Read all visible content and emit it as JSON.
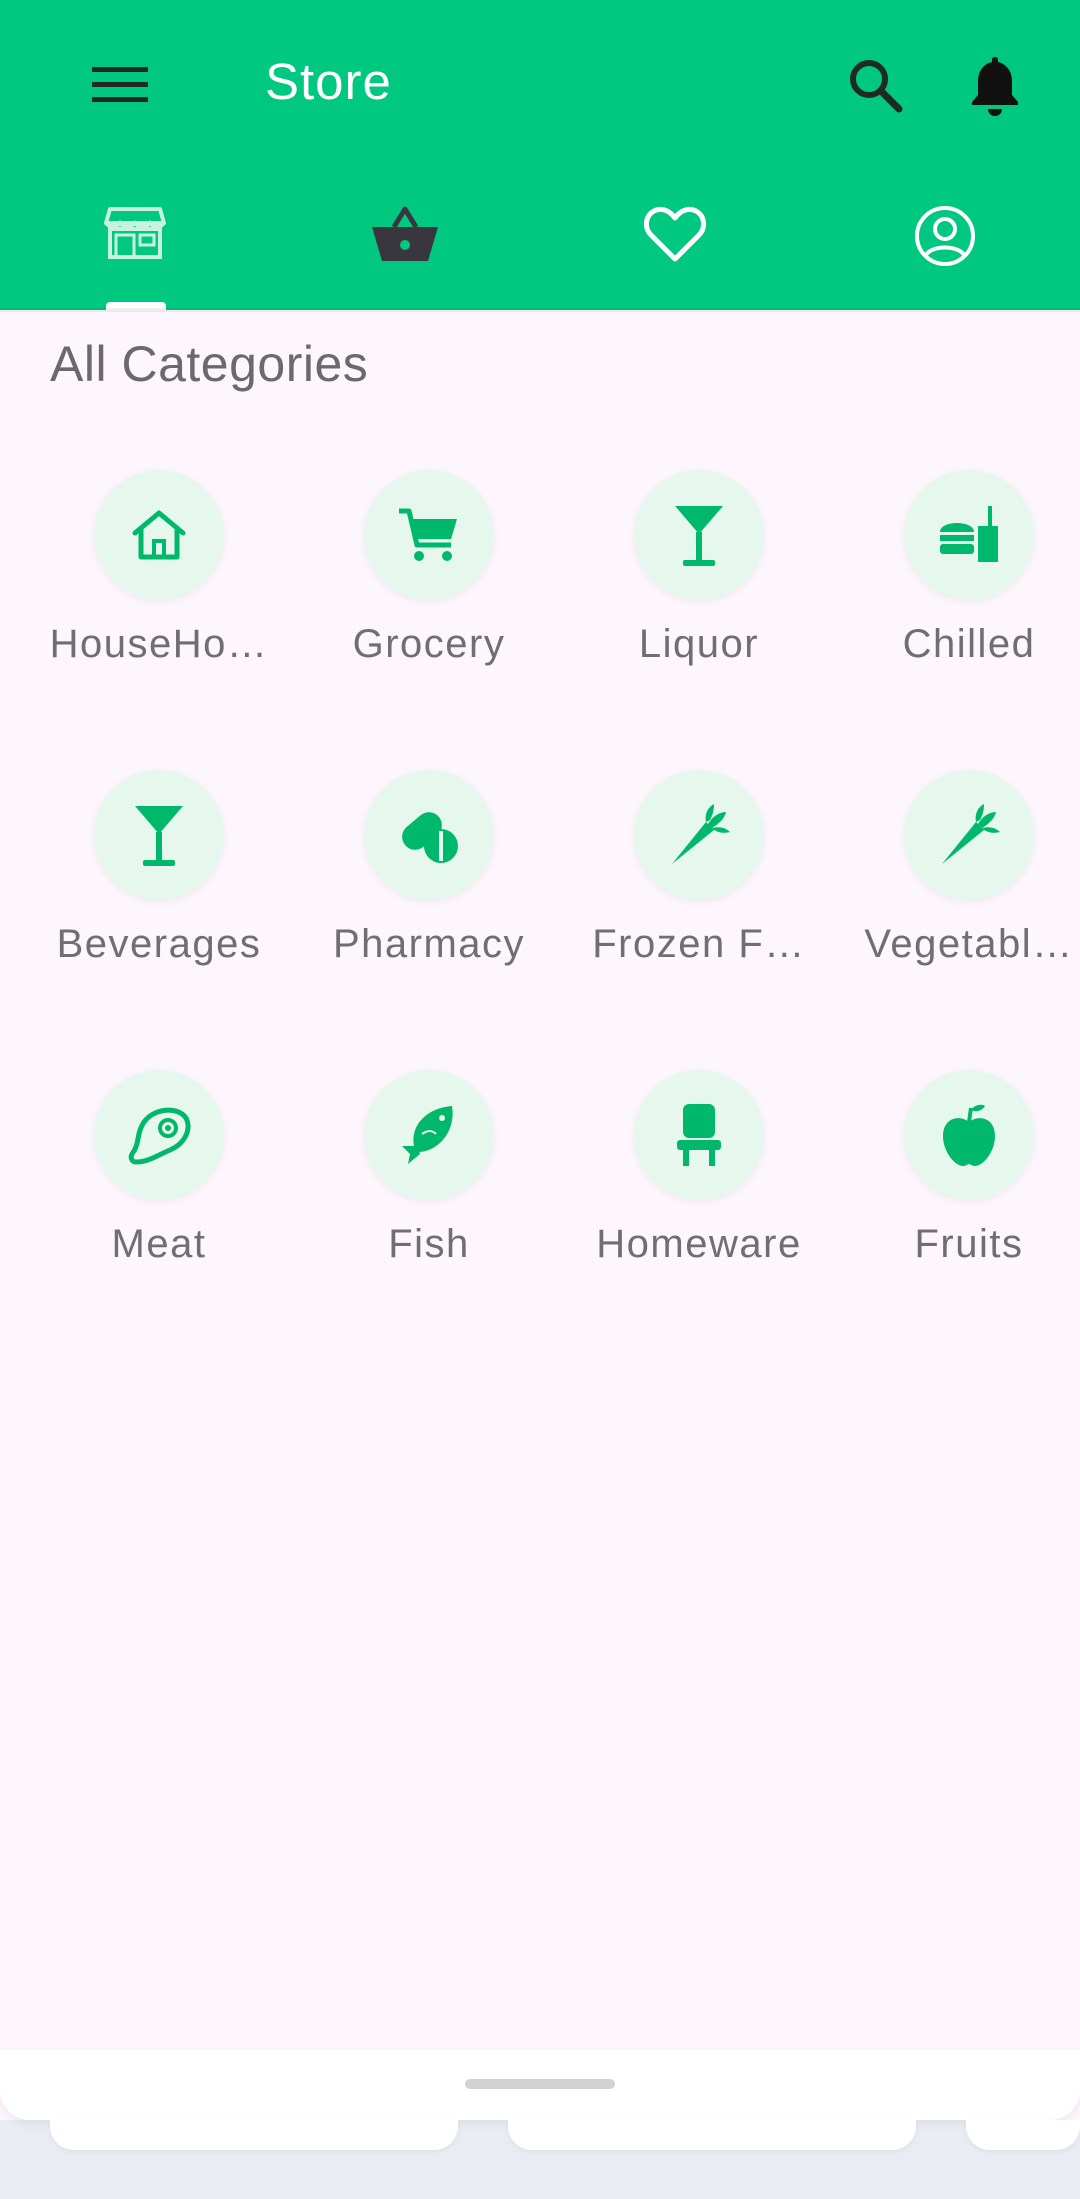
{
  "app": {
    "title": "Store"
  },
  "header": {
    "menu_icon": "hamburger-menu-icon",
    "search_icon": "search-icon",
    "notification_icon": "bell-icon"
  },
  "tabs": [
    {
      "icon": "storefront-icon",
      "selected": true
    },
    {
      "icon": "basket-icon",
      "selected": false
    },
    {
      "icon": "heart-icon",
      "selected": false
    },
    {
      "icon": "account-circle-icon",
      "selected": false
    }
  ],
  "section": {
    "title": "All Categories"
  },
  "categories": [
    {
      "label": "HouseHo…",
      "icon": "house-icon"
    },
    {
      "label": "Grocery",
      "icon": "cart-icon"
    },
    {
      "label": "Liquor",
      "icon": "cocktail-icon"
    },
    {
      "label": "Chilled",
      "icon": "burger-drink-icon"
    },
    {
      "label": "Beverages",
      "icon": "cocktail-icon"
    },
    {
      "label": "Pharmacy",
      "icon": "pills-icon"
    },
    {
      "label": "Frozen F…",
      "icon": "carrot-icon"
    },
    {
      "label": "Vegetabl…",
      "icon": "carrot-icon"
    },
    {
      "label": "Meat",
      "icon": "steak-icon"
    },
    {
      "label": "Fish",
      "icon": "fish-icon"
    },
    {
      "label": "Homeware",
      "icon": "chair-icon"
    },
    {
      "label": "Fruits",
      "icon": "apple-icon"
    }
  ],
  "colors": {
    "primary": "#00c880",
    "accent_icon": "#00b86b",
    "circle_bg": "#e6f8ee",
    "page_bg": "#fdf6fd"
  }
}
